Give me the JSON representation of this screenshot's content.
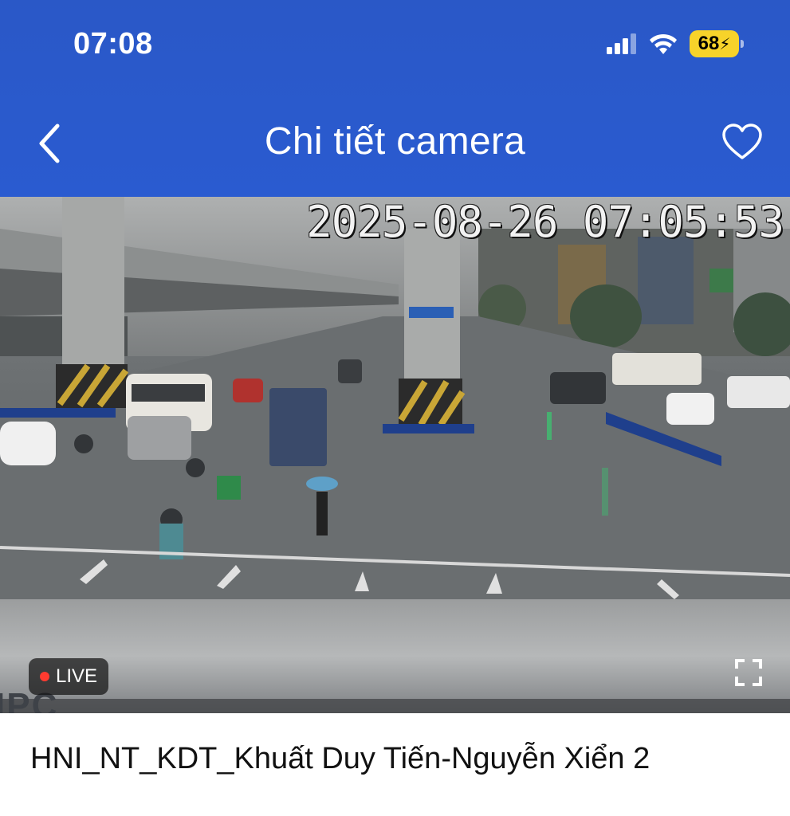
{
  "status_bar": {
    "time": "07:08",
    "battery_level": "68",
    "battery_charging": true,
    "signal_icon": "cellular-signal-icon",
    "wifi_icon": "wifi-icon"
  },
  "header": {
    "title": "Chi tiết camera",
    "back_icon": "chevron-left-icon",
    "favorite_icon": "heart-outline-icon",
    "background_color": "#2a58c7"
  },
  "video": {
    "timestamp": "2025-08-26 07:05:53",
    "live_label": "LIVE",
    "watermark": "IPC",
    "fullscreen_icon": "fullscreen-icon"
  },
  "camera": {
    "name": "HNI_NT_KDT_Khuất Duy Tiến-Nguyễn Xiển 2"
  }
}
